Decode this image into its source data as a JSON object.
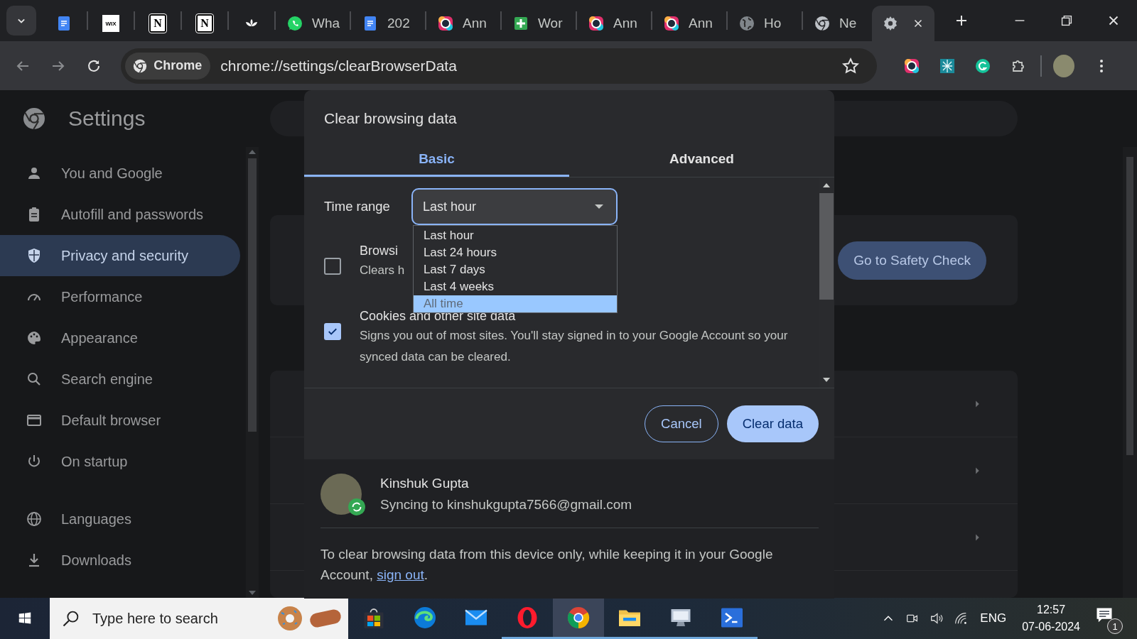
{
  "tabs": [
    {
      "kind": "docs",
      "selected": false
    },
    {
      "kind": "wix",
      "icon_text": "WIX",
      "selected": false
    },
    {
      "kind": "notion",
      "icon_text": "N",
      "selected": false
    },
    {
      "kind": "notion",
      "icon_text": "N",
      "selected": false
    },
    {
      "kind": "lotus",
      "selected": false
    },
    {
      "kind": "whatsapp",
      "label": "Wha",
      "selected": false
    },
    {
      "kind": "docs",
      "label": "202",
      "selected": false
    },
    {
      "kind": "camera",
      "label": "Ann",
      "selected": false
    },
    {
      "kind": "sheets",
      "label": "Wor",
      "selected": false
    },
    {
      "kind": "camera",
      "label": "Ann",
      "selected": false
    },
    {
      "kind": "camera",
      "label": "Ann",
      "selected": false
    },
    {
      "kind": "globe",
      "label": "Ho",
      "selected": false
    },
    {
      "kind": "chrome",
      "label": "Ne",
      "selected": false
    },
    {
      "kind": "settings",
      "selected": true
    }
  ],
  "toolbar": {
    "chip": "Chrome",
    "url": "chrome://settings/clearBrowserData",
    "extensions": [
      {
        "kind": "camera"
      },
      {
        "kind": "teal"
      },
      {
        "kind": "grammar"
      },
      {
        "kind": "puzzle"
      }
    ]
  },
  "sidebar": {
    "title": "Settings",
    "items": [
      {
        "kind": "person",
        "label": "You and Google",
        "selected": false
      },
      {
        "kind": "clipboard",
        "label": "Autofill and passwords",
        "selected": false
      },
      {
        "kind": "shield",
        "label": "Privacy and security",
        "selected": true
      },
      {
        "kind": "gauge",
        "label": "Performance",
        "selected": false
      },
      {
        "kind": "palette",
        "label": "Appearance",
        "selected": false
      },
      {
        "kind": "search",
        "label": "Search engine",
        "selected": false
      },
      {
        "kind": "window",
        "label": "Default browser",
        "selected": false
      },
      {
        "kind": "power",
        "label": "On startup",
        "selected": false
      }
    ],
    "more_items": [
      {
        "kind": "globe",
        "label": "Languages",
        "selected": false
      },
      {
        "kind": "download",
        "label": "Downloads",
        "selected": false
      }
    ]
  },
  "safety_check_button": "Go to Safety Check",
  "dialog": {
    "title": "Clear browsing data",
    "tabs": [
      {
        "label": "Basic",
        "selected": true
      },
      {
        "label": "Advanced",
        "selected": false
      }
    ],
    "time_range": {
      "label": "Time range",
      "value": "Last hour",
      "options": [
        {
          "label": "Last hour",
          "highlighted": false
        },
        {
          "label": "Last 24 hours",
          "highlighted": false
        },
        {
          "label": "Last 7 days",
          "highlighted": false
        },
        {
          "label": "Last 4 weeks",
          "highlighted": false
        },
        {
          "label": "All time",
          "highlighted": true
        }
      ]
    },
    "items": [
      {
        "title": "Browsi",
        "description": "Clears h",
        "checked": false
      },
      {
        "title": "Cookies and other site data",
        "description": "Signs you out of most sites. You'll stay signed in to your Google Account so your synced data can be cleared.",
        "checked": true
      }
    ],
    "buttons": [
      {
        "label": "Cancel",
        "kind": "outline"
      },
      {
        "label": "Clear data",
        "kind": "filled"
      }
    ],
    "account": {
      "name": "Kinshuk Gupta",
      "status": "Syncing to kinshukgupta7566@gmail.com"
    },
    "note": {
      "text": "To clear browsing data from this device only, while keeping it in your Google Account, ",
      "link": "sign out",
      "end": "."
    }
  },
  "taskbar": {
    "search_placeholder": "Type here to search",
    "apps": [
      {
        "kind": "store",
        "running": false,
        "selected": false
      },
      {
        "kind": "edge",
        "running": false,
        "selected": false
      },
      {
        "kind": "mail",
        "running": false,
        "selected": false
      },
      {
        "kind": "opera",
        "running": true,
        "selected": false
      },
      {
        "kind": "chrome",
        "running": true,
        "selected": true
      },
      {
        "kind": "folder",
        "running": true,
        "selected": false
      },
      {
        "kind": "computer",
        "running": true,
        "selected": false
      },
      {
        "kind": "terminal",
        "running": true,
        "selected": false
      }
    ],
    "language": "ENG",
    "time": "12:57",
    "date": "07-06-2024",
    "notifications": "1"
  }
}
